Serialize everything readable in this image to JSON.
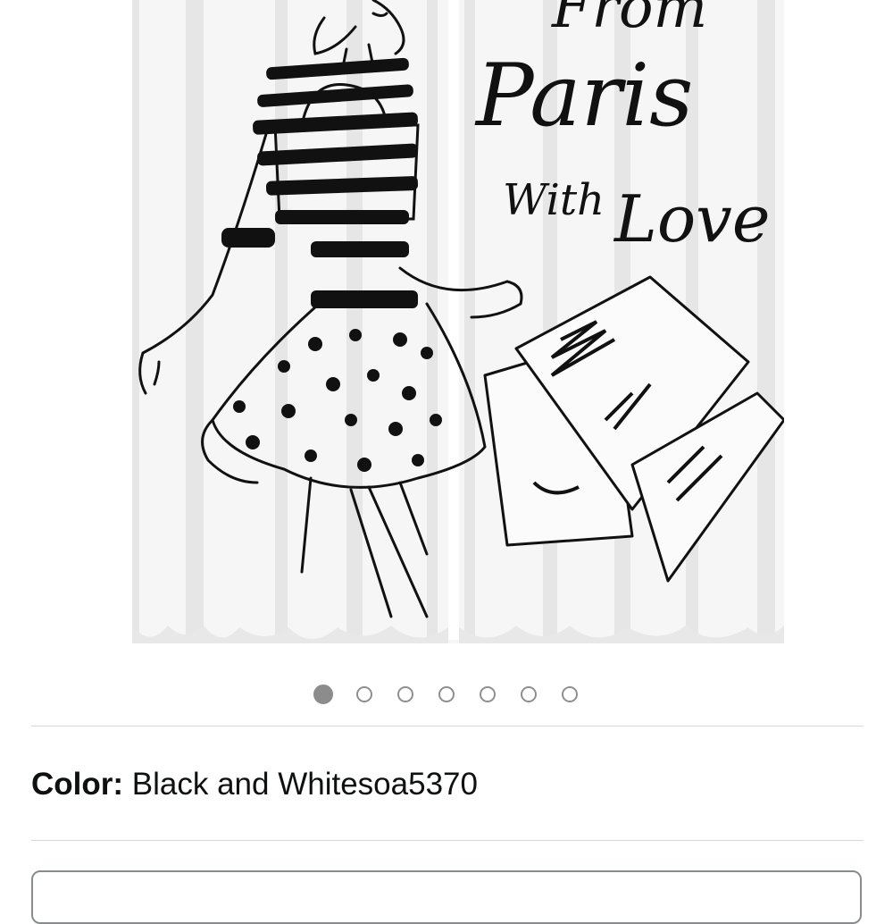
{
  "product_image": {
    "alt": "curtain",
    "art_text": [
      "From",
      "Paris",
      "With",
      "Love"
    ],
    "colors": {
      "ink": "#111111",
      "fabric": "#f6f6f6",
      "fold_shadow": "#e4e4e4"
    }
  },
  "carousel": {
    "count": 7,
    "active_index": 0,
    "active_color": "#8c8c8c",
    "inactive_border": "#8f8f8f"
  },
  "color_selector": {
    "label": "Color:",
    "value": "Black and Whitesoa5370"
  },
  "colors": {
    "divider": "#d5d9d9",
    "text": "#0f1111",
    "box_border": "#888c8c"
  }
}
